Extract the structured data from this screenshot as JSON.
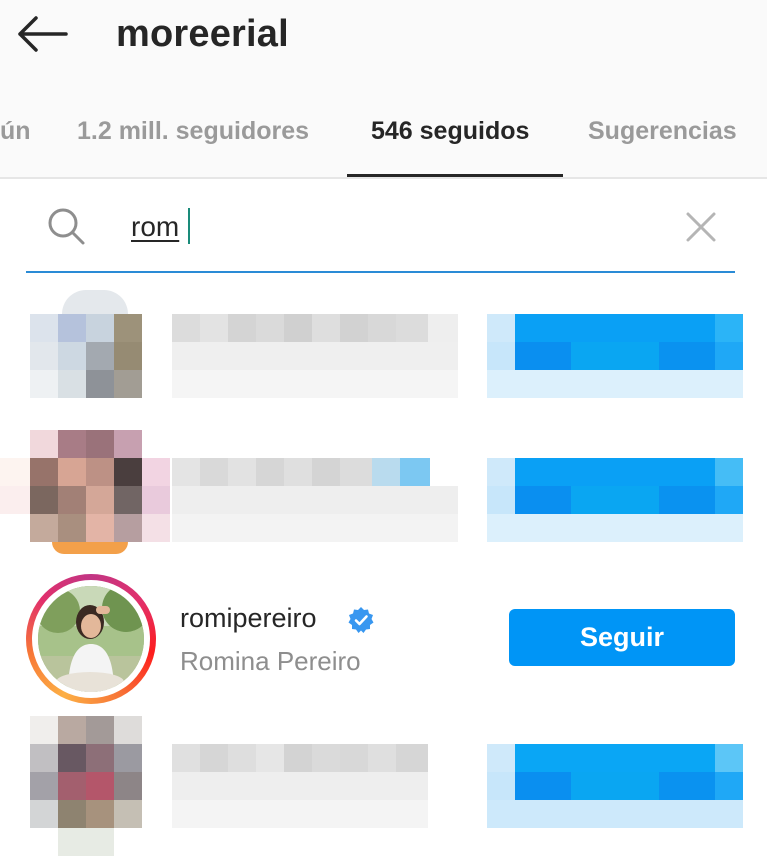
{
  "header": {
    "back_icon": "arrow-left-icon",
    "title": "moreerial"
  },
  "tabs": [
    {
      "label": "ún",
      "active": false
    },
    {
      "label": "1.2 mill. seguidores",
      "active": false
    },
    {
      "label": "546 seguidos",
      "active": true
    },
    {
      "label": "Sugerencias",
      "active": false
    }
  ],
  "search": {
    "icon": "search-icon",
    "value": "rom",
    "clear_icon": "close-icon"
  },
  "results": [
    {
      "username": "",
      "full_name": "",
      "pixelated": true
    },
    {
      "username": "",
      "full_name": "",
      "pixelated": true
    },
    {
      "username": "romipereiro",
      "full_name": "Romina Pereiro",
      "verified": true,
      "verified_icon": "verified-badge-icon",
      "button_label": "Seguir",
      "pixelated": false
    },
    {
      "username": "",
      "full_name": "",
      "pixelated": true
    }
  ],
  "colors": {
    "accent": "#0095f6",
    "underline": "#2a8bd6",
    "muted_text": "#8e8e8e"
  }
}
